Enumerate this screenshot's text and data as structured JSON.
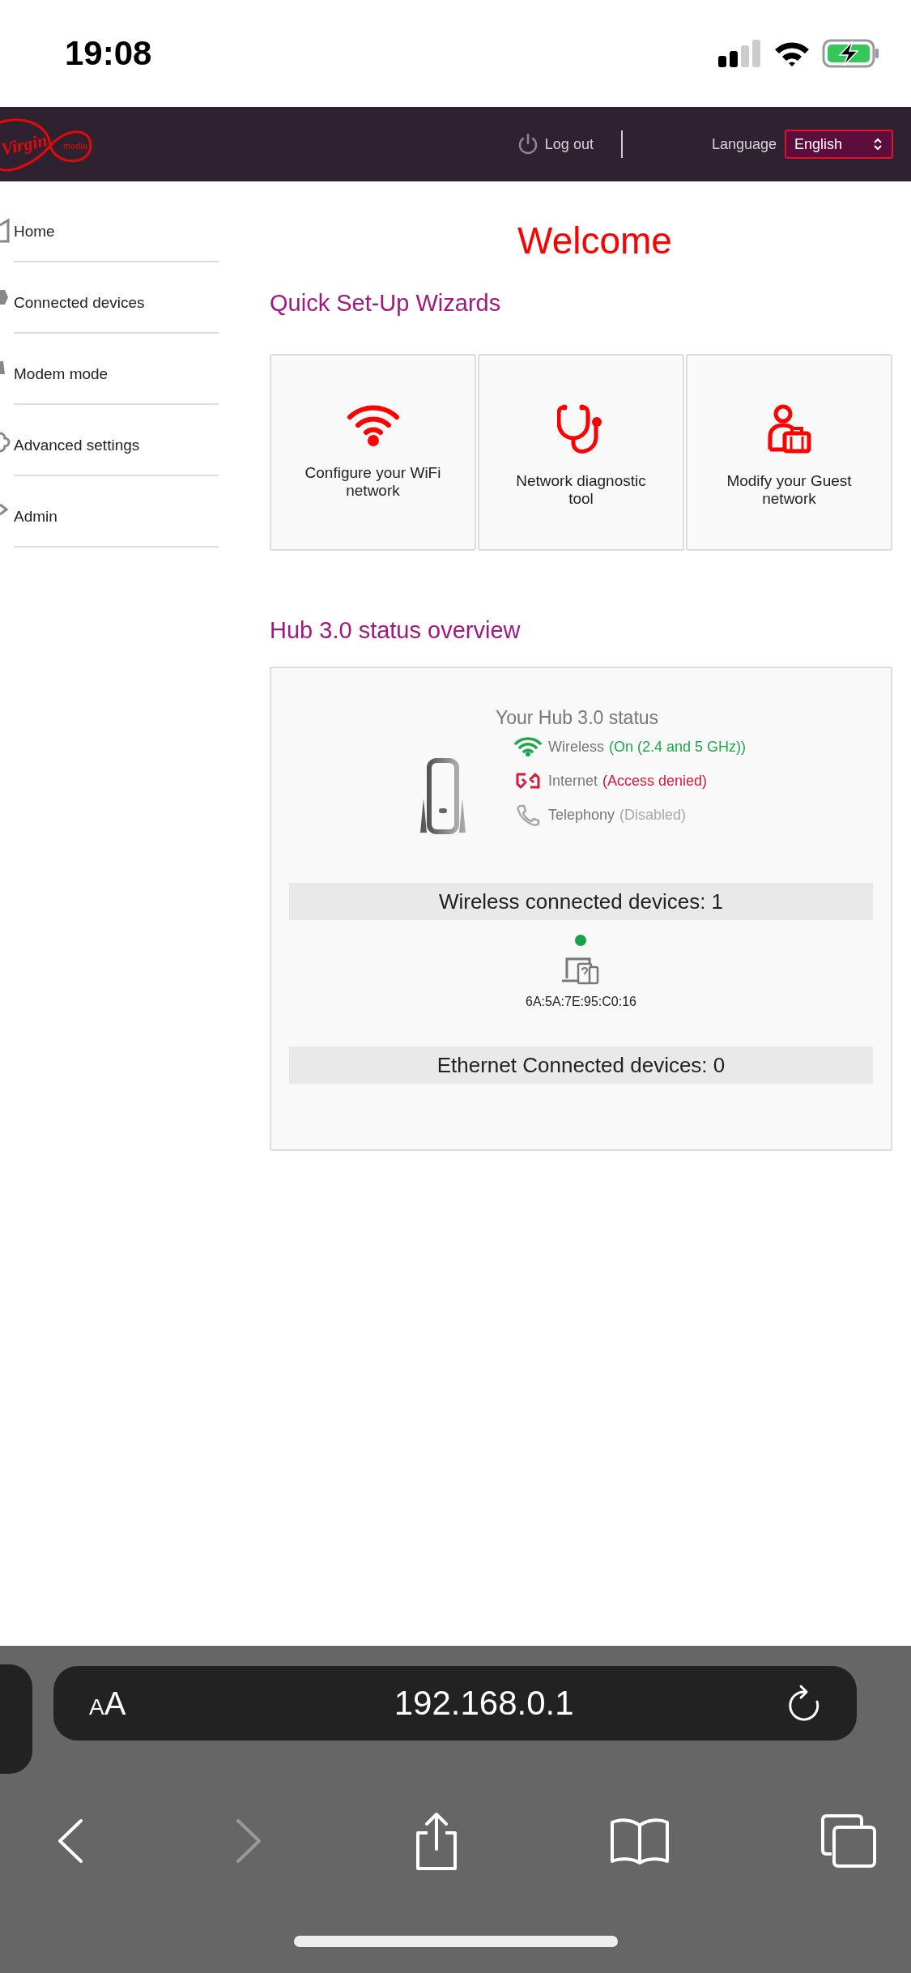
{
  "status_bar": {
    "time": "19:08"
  },
  "header": {
    "logo": {
      "brand": "Virgin",
      "sub": "media"
    },
    "logout": "Log out",
    "language_label": "Language",
    "language": "English"
  },
  "sidebar": {
    "items": [
      {
        "label": "Home"
      },
      {
        "label": "Connected devices"
      },
      {
        "label": "Modem mode"
      },
      {
        "label": "Advanced settings"
      },
      {
        "label": "Admin"
      }
    ]
  },
  "title": "Welcome",
  "wizards": {
    "heading": "Quick Set-Up Wizards",
    "cards": [
      {
        "label": "Configure your WiFi network"
      },
      {
        "label": "Network diagnostic tool"
      },
      {
        "label": "Modify your Guest network"
      }
    ]
  },
  "overview": {
    "heading": "Hub 3.0 status overview",
    "status_title": "Your Hub 3.0 status",
    "rows": [
      {
        "label": "Wireless",
        "status": "(On (2.4 and 5 GHz))",
        "kind": "ok"
      },
      {
        "label": "Internet",
        "status": "(Access denied)",
        "kind": "error"
      },
      {
        "label": "Telephony",
        "status": "(Disabled)",
        "kind": "disabled"
      }
    ],
    "wireless": {
      "title": "Wireless connected devices: 1",
      "devices": [
        {
          "mac": "6A:5A:7E:95:C0:16",
          "color": "#16a34a"
        }
      ]
    },
    "ethernet": {
      "title": "Ethernet Connected devices: 0"
    }
  },
  "browser": {
    "text_size": "AA",
    "url": "192.168.0.1",
    "back_disabled": false,
    "forward_disabled": true
  }
}
